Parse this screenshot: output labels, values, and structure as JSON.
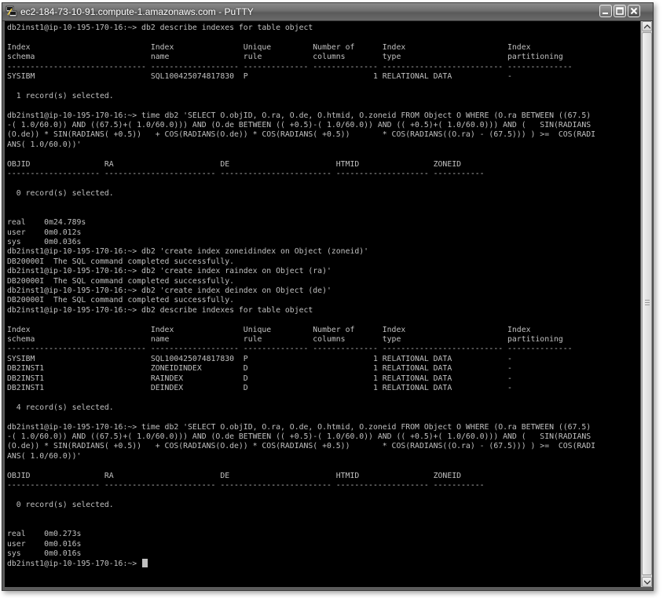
{
  "window": {
    "title": "ec2-184-73-10-91.compute-1.amazonaws.com - PuTTY",
    "app_icon": "putty-icon",
    "controls": [
      "minimize-icon",
      "maximize-icon",
      "close-icon"
    ]
  },
  "terminal": {
    "lines": [
      "db2inst1@ip-10-195-170-16:~> db2 describe indexes for table object",
      "",
      "Index                          Index               Unique         Number of      Index                      Index",
      "schema                         name                rule           columns        type                       partitioning",
      "------------------------------ ------------------- -------------- -------------- -------------------------- --------------",
      "SYSIBM                         SQL100425074817830  P                           1 RELATIONAL DATA            -",
      "",
      "  1 record(s) selected.",
      "",
      "db2inst1@ip-10-195-170-16:~> time db2 'SELECT O.objID, O.ra, O.de, O.htmid, O.zoneid FROM Object O WHERE (O.ra BETWEEN ((67.5)",
      "-( 1.0/60.0)) AND ((67.5)+( 1.0/60.0))) AND (O.de BETWEEN (( +0.5)-( 1.0/60.0)) AND (( +0.5)+( 1.0/60.0))) AND (   SIN(RADIANS",
      "(O.de)) * SIN(RADIANS( +0.5))   + COS(RADIANS(O.de)) * COS(RADIANS( +0.5))       * COS(RADIANS((O.ra) - (67.5))) ) >=  COS(RADI",
      "ANS( 1.0/60.0))'",
      "",
      "OBJID                RA                       DE                       HTMID                ZONEID",
      "-------------------- ------------------------ ------------------------ -------------------- -----------",
      "",
      "  0 record(s) selected.",
      "",
      "",
      "real    0m24.789s",
      "user    0m0.012s",
      "sys     0m0.036s",
      "db2inst1@ip-10-195-170-16:~> db2 'create index zoneidindex on Object (zoneid)'",
      "DB20000I  The SQL command completed successfully.",
      "db2inst1@ip-10-195-170-16:~> db2 'create index raindex on Object (ra)'",
      "DB20000I  The SQL command completed successfully.",
      "db2inst1@ip-10-195-170-16:~> db2 'create index deindex on Object (de)'",
      "DB20000I  The SQL command completed successfully.",
      "db2inst1@ip-10-195-170-16:~> db2 describe indexes for table object",
      "",
      "Index                          Index               Unique         Number of      Index                      Index",
      "schema                         name                rule           columns        type                       partitioning",
      "------------------------------ ------------------- -------------- -------------- -------------------------- --------------",
      "SYSIBM                         SQL100425074817830  P                           1 RELATIONAL DATA            -",
      "DB2INST1                       ZONEIDINDEX         D                           1 RELATIONAL DATA            -",
      "DB2INST1                       RAINDEX             D                           1 RELATIONAL DATA            -",
      "DB2INST1                       DEINDEX             D                           1 RELATIONAL DATA            -",
      "",
      "  4 record(s) selected.",
      "",
      "db2inst1@ip-10-195-170-16:~> time db2 'SELECT O.objID, O.ra, O.de, O.htmid, O.zoneid FROM Object O WHERE (O.ra BETWEEN ((67.5)",
      "-( 1.0/60.0)) AND ((67.5)+( 1.0/60.0))) AND (O.de BETWEEN (( +0.5)-( 1.0/60.0)) AND (( +0.5)+( 1.0/60.0))) AND (   SIN(RADIANS",
      "(O.de)) * SIN(RADIANS( +0.5))   + COS(RADIANS(O.de)) * COS(RADIANS( +0.5))       * COS(RADIANS((O.ra) - (67.5))) ) >=  COS(RADI",
      "ANS( 1.0/60.0))'",
      "",
      "OBJID                RA                       DE                       HTMID                ZONEID",
      "-------------------- ------------------------ ------------------------ -------------------- -----------",
      "",
      "  0 record(s) selected.",
      "",
      "",
      "real    0m0.273s",
      "user    0m0.016s",
      "sys     0m0.016s"
    ],
    "prompt": "db2inst1@ip-10-195-170-16:~> ",
    "text_color": "#c0c0c0",
    "background": "#000000"
  },
  "scrollbar": {
    "icons": [
      "scroll-up-arrow-icon",
      "scroll-down-arrow-icon"
    ]
  }
}
